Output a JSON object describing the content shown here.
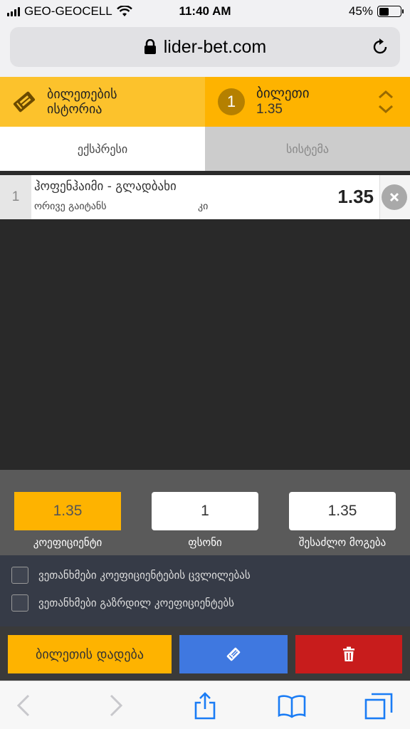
{
  "status_bar": {
    "carrier": "GEO-GEOCELL",
    "time": "11:40 AM",
    "battery": "45%",
    "battery_level": 0.45
  },
  "browser": {
    "url": "lider-bet.com",
    "icons": [
      "lock-icon",
      "reload-icon",
      "back-icon",
      "forward-icon",
      "share-icon",
      "bookmarks-icon",
      "tabs-icon"
    ]
  },
  "header": {
    "history_label": "ბილეთების ისტორია",
    "ticket_count": "1",
    "ticket_label": "ბილეთი",
    "ticket_odds": "1.35"
  },
  "mode_tabs": [
    {
      "label": "ექსპრესი",
      "active": true
    },
    {
      "label": "სისტემა",
      "active": false
    }
  ],
  "bets": [
    {
      "index": "1",
      "match": "ჰოფენჰაიმი - გლადბახი",
      "outcome": "ორივე გაიტანს",
      "answer": "კი",
      "odds": "1.35"
    }
  ],
  "stake_panel": {
    "odds_value": "1.35",
    "odds_label": "კოეფიციენტი",
    "stake_value": "1",
    "stake_label": "ფსონი",
    "win_value": "1.35",
    "win_label": "შესაძლო მოგება"
  },
  "agreements": [
    "ვეთანხმები კოეფიციენტების ცვლილებას",
    "ვეთანხმები გაზრდილ კოეფიციენტებს"
  ],
  "actions": {
    "place_label": "ბილეთის დადება"
  },
  "colors": {
    "accent": "#feb300",
    "accent_light": "#fcc22c",
    "blue": "#3f78e0",
    "red": "#c81c1c"
  }
}
